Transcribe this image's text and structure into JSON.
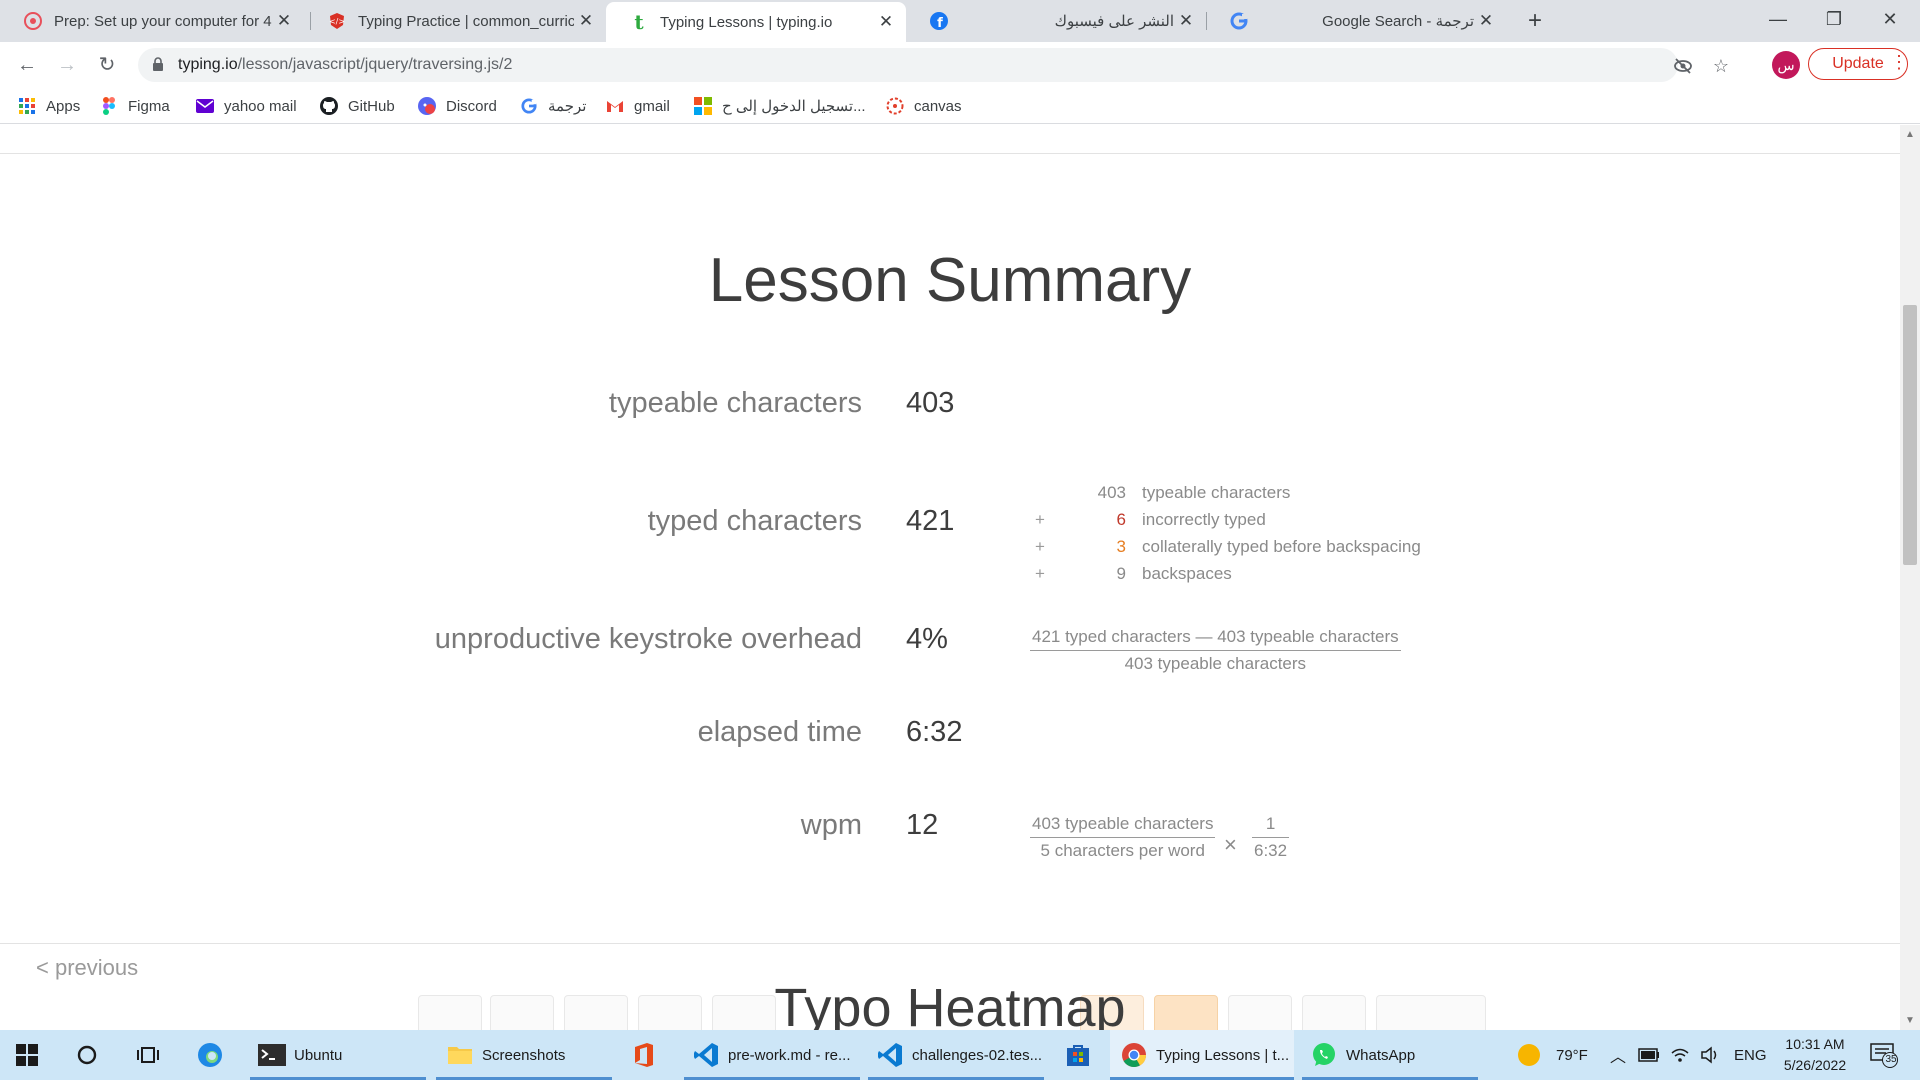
{
  "browser": {
    "tabs": [
      {
        "title": "Prep: Set up your computer for 4",
        "icon": "asana-icon",
        "active": false
      },
      {
        "title": "Typing Practice | common_curricu",
        "icon": "code-icon",
        "active": false
      },
      {
        "title": "Typing Lessons | typing.io",
        "icon": "typing-io-icon",
        "active": true
      },
      {
        "title": "النشر على فيسبوك",
        "icon": "facebook-icon",
        "active": false
      },
      {
        "title": "Google Search - ترجمة",
        "icon": "google-icon",
        "active": false
      }
    ],
    "url_host": "typing.io",
    "url_path": "/lesson/javascript/jquery/traversing.js/2",
    "avatar_letter": "س",
    "update_label": "Update",
    "bookmarks": [
      {
        "label": "Apps",
        "icon": "apps-grid-icon"
      },
      {
        "label": "Figma",
        "icon": "figma-icon"
      },
      {
        "label": "yahoo mail",
        "icon": "mail-icon"
      },
      {
        "label": "GitHub",
        "icon": "github-icon"
      },
      {
        "label": "Discord",
        "icon": "discord-icon"
      },
      {
        "label": "ترجمة",
        "icon": "google-icon"
      },
      {
        "label": "gmail",
        "icon": "gmail-icon"
      },
      {
        "label": "تسجيل الدخول إلى ح...",
        "icon": "microsoft-icon"
      },
      {
        "label": "canvas",
        "icon": "canvas-icon"
      }
    ]
  },
  "summary": {
    "title": "Lesson Summary",
    "rows": [
      {
        "label": "typeable characters",
        "value": "403"
      },
      {
        "label": "typed characters",
        "value": "421"
      },
      {
        "label": "unproductive keystroke overhead",
        "value": "4%"
      },
      {
        "label": "elapsed time",
        "value": "6:32"
      },
      {
        "label": "wpm",
        "value": "12"
      }
    ],
    "breakdown": [
      {
        "op": "",
        "num": "403",
        "label": "typeable characters",
        "color": "#8a8a8a"
      },
      {
        "op": "+",
        "num": "6",
        "label": "incorrectly typed",
        "color": "#c0392b"
      },
      {
        "op": "+",
        "num": "3",
        "label": "collaterally typed before backspacing",
        "color": "#e67e22"
      },
      {
        "op": "+",
        "num": "9",
        "label": "backspaces",
        "color": "#8a8a8a"
      }
    ],
    "overhead_formula": {
      "numerator": "421 typed characters — 403 typeable characters",
      "denominator": "403 typeable characters"
    },
    "wpm_formula": {
      "numerator1": "403 typeable characters",
      "denominator1": "5 characters per word",
      "times": "×",
      "numerator2": "1",
      "denominator2": "6:32"
    },
    "previous_link": "< previous",
    "heatmap_title": "Typo Heatmap"
  },
  "taskbar": {
    "items": [
      {
        "label": "Ubuntu",
        "icon": "terminal-icon"
      },
      {
        "label": "Screenshots",
        "icon": "folder-icon"
      },
      {
        "label": "",
        "icon": "office-icon"
      },
      {
        "label": "pre-work.md - re...",
        "icon": "vscode-icon"
      },
      {
        "label": "challenges-02.tes...",
        "icon": "vscode-icon"
      },
      {
        "label": "",
        "icon": "store-icon"
      },
      {
        "label": "Typing Lessons | t...",
        "icon": "chrome-icon"
      },
      {
        "label": "WhatsApp",
        "icon": "whatsapp-icon"
      }
    ],
    "weather": "79°F",
    "language": "ENG",
    "time": "10:31 AM",
    "date": "5/26/2022",
    "notifications": "35"
  }
}
